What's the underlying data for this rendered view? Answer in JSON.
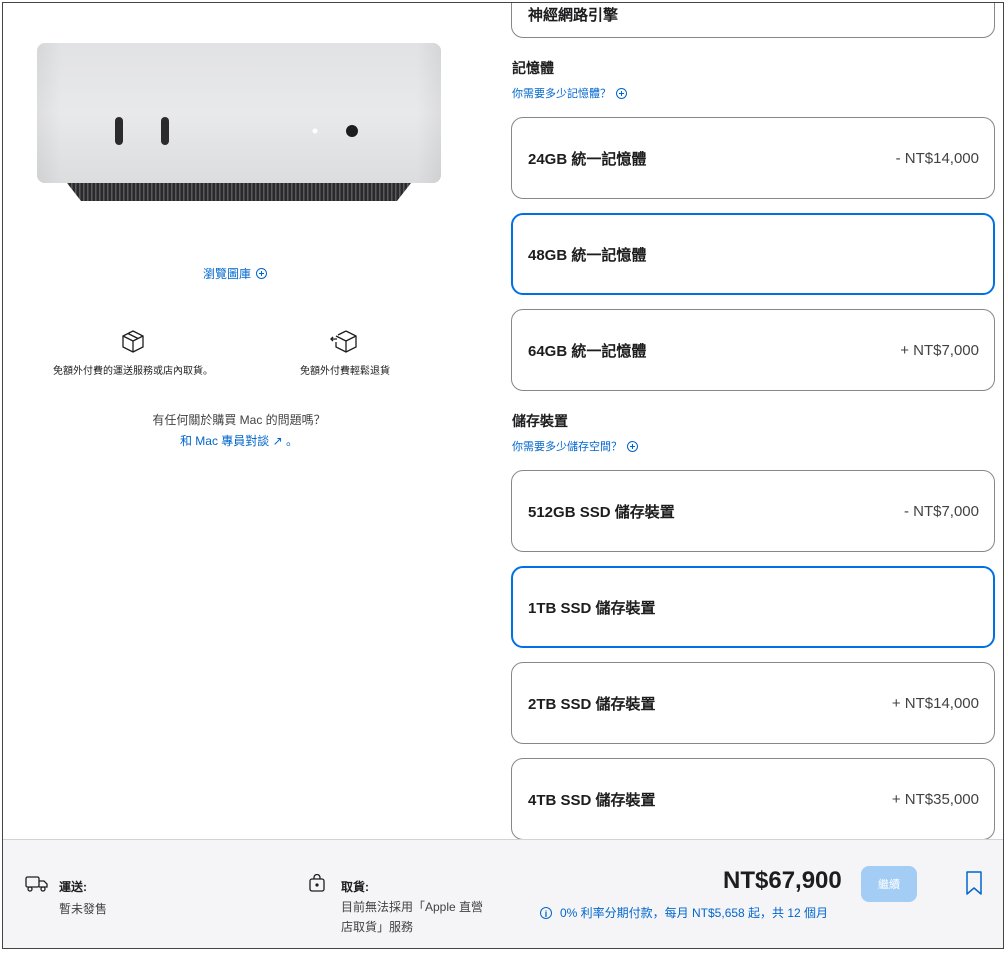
{
  "gallery": {
    "label": "瀏覽圖庫"
  },
  "perks": {
    "shipping": "免額外付費的運送服務或店內取貨。",
    "returns": "免額外付費輕鬆退貨"
  },
  "help": {
    "question": "有任何關於購買 Mac 的問題嗎？",
    "link": "和 Mac 專員對談 ↗ 。"
  },
  "top_option": {
    "label": "神經網路引擎"
  },
  "memory": {
    "title": "記憶體",
    "help": "你需要多少記憶體？",
    "options": [
      {
        "label": "24GB 統一記憶體",
        "price": "- NT$14,000"
      },
      {
        "label": "48GB 統一記憶體",
        "price": ""
      },
      {
        "label": "64GB 統一記憶體",
        "price": "+ NT$7,000"
      }
    ],
    "selected": "48GB 統一記憶體"
  },
  "storage": {
    "title": "儲存裝置",
    "help": "你需要多少儲存空間？",
    "options": [
      {
        "label": "512GB SSD 儲存裝置",
        "price": "- NT$7,000"
      },
      {
        "label": "1TB SSD 儲存裝置",
        "price": ""
      },
      {
        "label": "2TB SSD 儲存裝置",
        "price": "+ NT$14,000"
      },
      {
        "label": "4TB SSD 儲存裝置",
        "price": "+ NT$35,000"
      }
    ],
    "selected": "1TB SSD 儲存裝置"
  },
  "bottom": {
    "delivery_title": "運送:",
    "delivery_status": "暫未發售",
    "pickup_title": "取貨:",
    "pickup_line1": "目前無法採用「Apple 直營",
    "pickup_line2": "店取貨」服務",
    "total": "NT$67,900",
    "continue": "繼續",
    "finance": "0% 利率分期付款，每月 NT$5,658 起，共 12 個月"
  },
  "colors": {
    "accent": "#0071e3",
    "link": "#0066cc",
    "disabled_button": "#a3cdf5",
    "bar_background": "#f5f5f7"
  },
  "icons": [
    "box-icon",
    "return-box-icon",
    "plus-circle-icon",
    "truck-icon",
    "shopping-bag-icon",
    "info-icon",
    "bookmark-icon"
  ]
}
